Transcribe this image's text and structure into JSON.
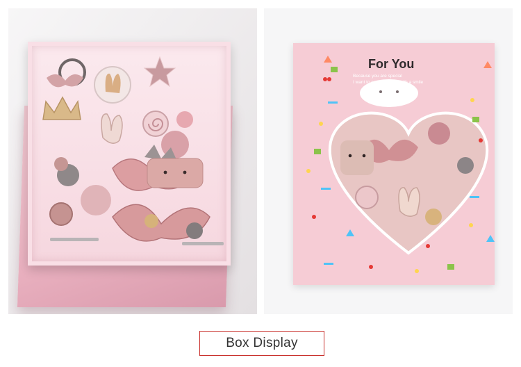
{
  "caption": {
    "label": "Box Display"
  },
  "box_print": {
    "title": "For You",
    "line1": "Because you are special",
    "line2": "I want to see your face with a smile"
  },
  "colors": {
    "box_pink": "#f6ccd5",
    "caption_border": "#c9302c",
    "caption_text": "#333333"
  }
}
